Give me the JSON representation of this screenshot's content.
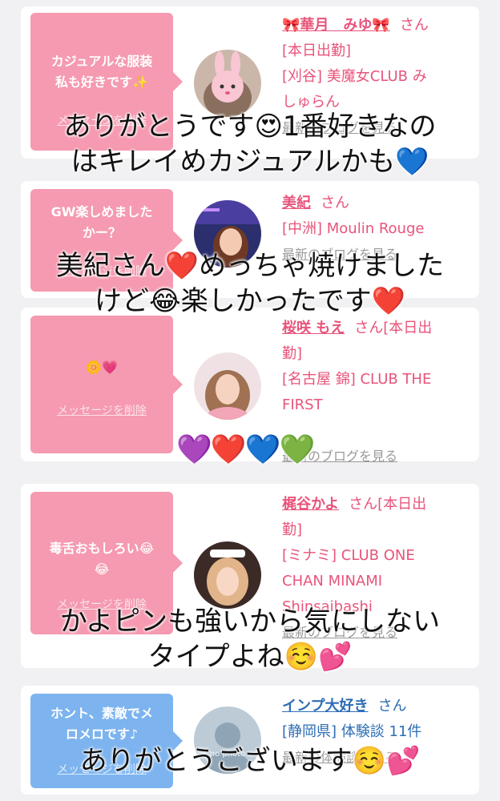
{
  "cards": [
    {
      "message": "カジュアルな服装私も好きです✨",
      "delete": "メッセージを削除",
      "name": "🎀華月　みゆ🎀",
      "honorific": "さん",
      "lines": [
        "[本日出勤]",
        "[刈谷] 美魔女CLUB みしゅらん"
      ],
      "blog": "最新のブログを見る"
    },
    {
      "message": "GW楽しめましたかー？",
      "delete": "メッセージを削除",
      "name": "美紀",
      "honorific": "さん",
      "lines": [
        "[中洲] Moulin Rouge"
      ],
      "blog": "最新のブログを見る"
    },
    {
      "message": "🌼💗",
      "delete": "メッセージを削除",
      "name": "桜咲 もえ",
      "honorific": "さん[本日出勤]",
      "lines": [
        "[名古屋 錦] CLUB THE FIRST"
      ],
      "blog": "最新のブログを見る"
    },
    {
      "message": "毒舌おもしろい😂😂",
      "delete": "メッセージを削除",
      "name": "梶谷かよ",
      "honorific": "さん[本日出勤]",
      "lines": [
        "[ミナミ] CLUB ONE CHAN MINAMI Shinsaibashi"
      ],
      "blog": "最新のブログを見る"
    },
    {
      "message": "ホント、素敵でメロメロです♪",
      "delete": "メッセージを削除",
      "name": "インプ大好き",
      "honorific": "さん",
      "lines": [
        "[静岡県] 体験談 11件"
      ],
      "blog": "最新の体験談を見る",
      "avatar_label": "no photo"
    }
  ],
  "overlays": {
    "o1": "ありがとうです😍1番好きなのはキレイめカジュアルかも💙",
    "o2": "美紀さん❤️めっちゃ焼けましたけど😂楽しかったです❤️",
    "o3": "💜❤️💙💚",
    "o4": "かよピンも強いから気にしないタイプよね☺️💕",
    "o5": "ありがとうございます☺️💕"
  },
  "colors": {
    "pink": "#f59ab0",
    "blue": "#7db4ef",
    "name_pink": "#e8547a",
    "name_blue": "#2d6db5"
  }
}
